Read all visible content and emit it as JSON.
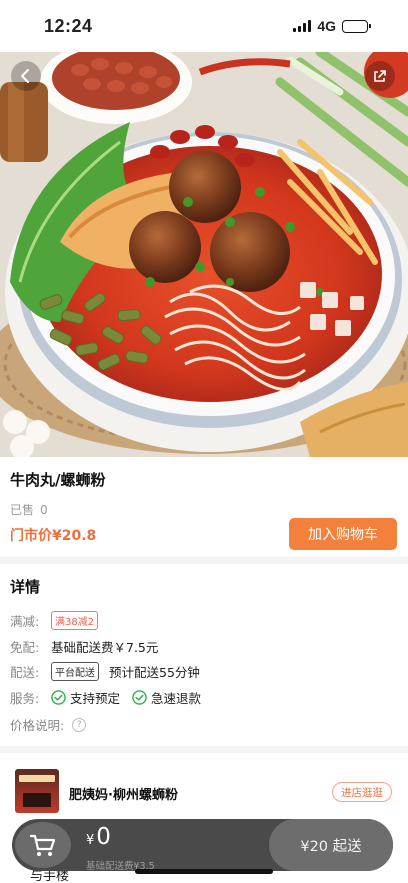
{
  "status_bar": {
    "time": "12:24",
    "network": "4G",
    "battery_fraction": 0.75
  },
  "hero": {
    "back_icon": "chevron-left-icon",
    "share_icon": "share-icon"
  },
  "product": {
    "name": "牛肉丸/螺蛳粉",
    "sold_label": "已售",
    "sold_count": "0",
    "price_label": "门市价¥20.8",
    "add_to_cart": "加入购物车",
    "accent_color": "#f4813b"
  },
  "details": {
    "title": "详情",
    "promo": {
      "label": "满减:",
      "tag": "满38减2"
    },
    "delivery_fee": {
      "label": "免配:",
      "value": "基础配送费￥7.5元"
    },
    "delivery": {
      "label": "配送:",
      "tag": "平台配送",
      "value": "预计配送55分钟"
    },
    "service": {
      "label": "服务:",
      "items": [
        "支持预定",
        "急速退款"
      ]
    },
    "price_note": {
      "label": "价格说明:",
      "icon": "?"
    }
  },
  "store": {
    "name": "肥姨妈·柳州螺蛳粉",
    "visit_button": "进店逛逛",
    "partial_text": "与手楼"
  },
  "cart": {
    "currency": "¥",
    "amount": "0",
    "delivery_fee_note": "基础配送费¥3.5",
    "min_order_button": "¥20 起送",
    "cart_icon": "cart-icon"
  }
}
